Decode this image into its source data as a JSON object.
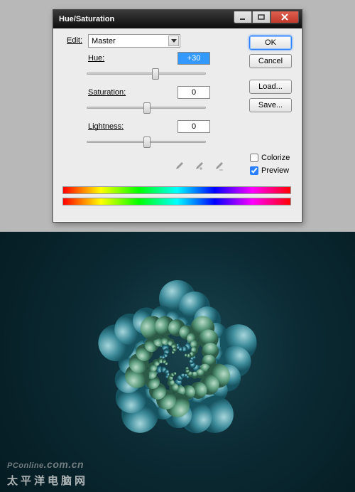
{
  "dialog": {
    "title": "Hue/Saturation",
    "edit_label": "Edit:",
    "edit_value": "Master",
    "hue_label": "Hue:",
    "hue_value": "+30",
    "sat_label": "Saturation:",
    "sat_value": "0",
    "light_label": "Lightness:",
    "light_value": "0",
    "ok": "OK",
    "cancel": "Cancel",
    "load": "Load...",
    "save": "Save...",
    "colorize": "Colorize",
    "preview": "Preview",
    "preview_checked": true,
    "colorize_checked": false
  },
  "slider_thumbs": {
    "hue": 92,
    "sat": 80,
    "light": 80
  },
  "watermark": {
    "brand": "PConline",
    "suffix": ".com.cn",
    "cn": "太平洋电脑网"
  }
}
